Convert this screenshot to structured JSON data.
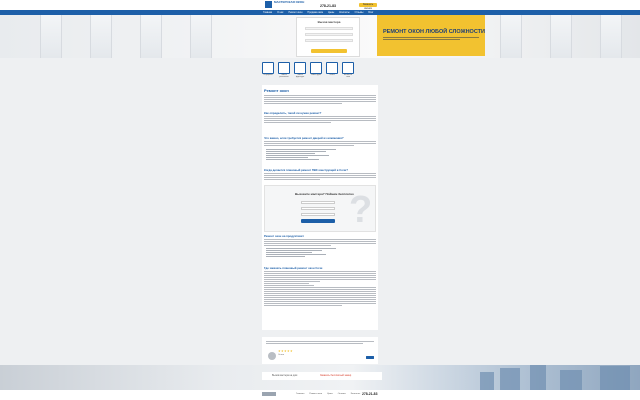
{
  "header": {
    "logo_text": "МАСТЕРСКАЯ ОКОН",
    "phone": "278-21-83",
    "callback_label": "Заказать звонок"
  },
  "nav": [
    "Главная",
    "О нас",
    "Ремонт окон",
    "Продажа окон",
    "Цены",
    "Контакты",
    "Отзывы",
    "Блог"
  ],
  "hero": {
    "form_title": "Вызов мастера",
    "banner_title": "РЕМОНТ ОКОН ЛЮБОЙ СЛОЖНОСТИ"
  },
  "services": [
    {
      "label": "Регулировка"
    },
    {
      "label": "Замена уплотнителя"
    },
    {
      "label": "Замена фурнитуры"
    },
    {
      "label": "Ремонт ручек"
    },
    {
      "label": "Откосы"
    },
    {
      "label": "Москитные сетки"
    }
  ],
  "main": {
    "title": "Ремонт окон",
    "headings": [
      "Как определить, такой ли нужен ремонт?",
      "Что важно, если требуется ремонт дверей из алюминия?",
      "Когда делается плановый ремонт ПВХ конструкций в Сочи?",
      "Ремонт окон на продуктивит",
      "Где заказать плановый ремонт окон Сочи"
    ],
    "promo_title": "Вызовите мастера? Поймем бесплатно"
  },
  "review": {
    "stars": "★★★★★",
    "author": "Отзыв"
  },
  "footer": {
    "cta_text": "Вызов мастера на дом",
    "cta_link": "Заказать бесплатный замер",
    "nav": [
      "Главная",
      "Ремонт окон",
      "Цены",
      "Отзывы",
      "Контакты"
    ],
    "phone": "278-21-83"
  },
  "colors": {
    "brand": "#1d5fa8",
    "accent": "#f2c230"
  }
}
